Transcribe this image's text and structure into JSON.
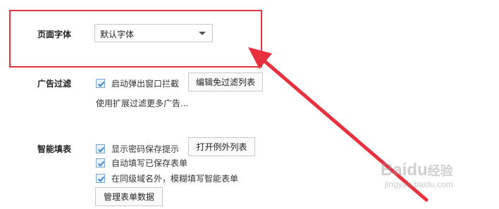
{
  "font_section": {
    "label": "页面字体",
    "selected": "默认字体"
  },
  "ad_filter": {
    "label": "广告过滤",
    "popup_block_label": "启动弹出窗口拦截",
    "popup_block_checked": true,
    "edit_exempt_button": "编辑免过滤列表",
    "more_link": "使用扩展过滤更多广告..."
  },
  "autofill": {
    "label": "智能填表",
    "options": [
      {
        "label": "显示密码保存提示",
        "checked": true
      },
      {
        "label": "自动填写已保存表单",
        "checked": true
      },
      {
        "label": "在同级域名外，模糊填写智能表单",
        "checked": true
      }
    ],
    "exceptions_button": "打开例外列表",
    "manage_button": "管理表单数据"
  },
  "watermark": {
    "brand": "Baidu",
    "brand_cn": "经验",
    "url": "jingyan.baidu.com"
  },
  "colors": {
    "highlight_red": "#e8303e",
    "checkbox_blue": "#2f7bd0"
  }
}
